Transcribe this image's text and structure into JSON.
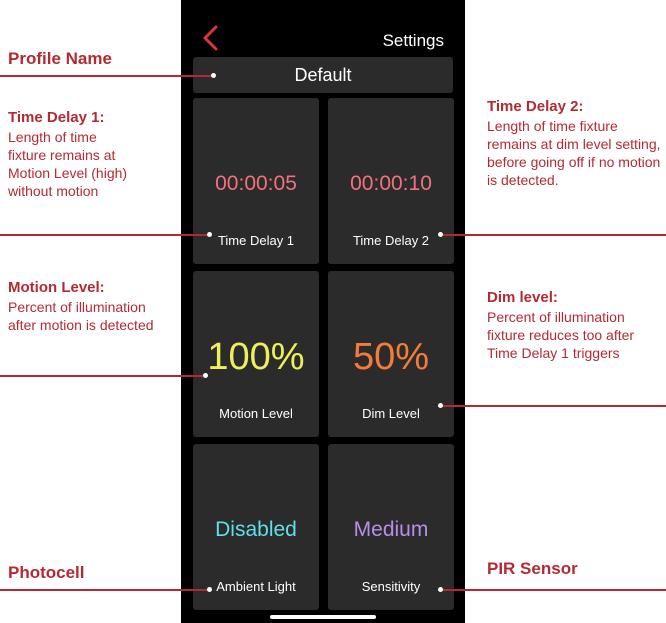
{
  "header": {
    "title": "Settings"
  },
  "profile": {
    "name": "Default"
  },
  "tiles": [
    {
      "value": "00:00:05",
      "label": "Time Delay 1",
      "color": "#f0727f"
    },
    {
      "value": "00:00:10",
      "label": "Time Delay 2",
      "color": "#f0727f"
    },
    {
      "value": "100%",
      "label": "Motion Level",
      "color": "#eef05a"
    },
    {
      "value": "50%",
      "label": "Dim Level",
      "color": "#f47b3c"
    },
    {
      "value": "Disabled",
      "label": "Ambient Light",
      "color": "#5ee0e6"
    },
    {
      "value": "Medium",
      "label": "Sensitivity",
      "color": "#b98ee8"
    }
  ],
  "annotations": {
    "profile_name": {
      "heading": "Profile Name"
    },
    "time_delay_1": {
      "heading": "Time Delay 1:",
      "body": "Length of time fixture remains at Motion Level (high) without motion"
    },
    "time_delay_2": {
      "heading": "Time Delay 2:",
      "body": "Length of time fixture remains at dim level setting, before going off if no motion is detected."
    },
    "motion_level": {
      "heading": "Motion Level:",
      "body": "Percent of illumination after motion is detected"
    },
    "dim_level": {
      "heading": "Dim level:",
      "body": "Percent of illumination fixture reduces too after Time Delay 1 triggers"
    },
    "photocell": {
      "heading": "Photocell"
    },
    "pir_sensor": {
      "heading": "PIR Sensor"
    }
  },
  "colors": {
    "accent": "#b52a32",
    "tile_bg": "#2b2b2b",
    "back_chevron": "#e0333f"
  },
  "icons": {
    "back": "chevron-left-icon"
  }
}
